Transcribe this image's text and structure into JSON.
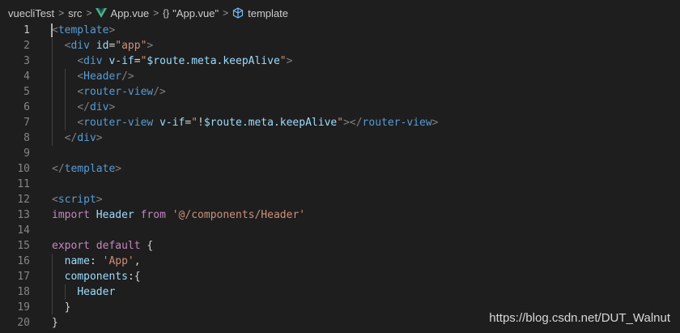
{
  "breadcrumb": {
    "folder1": "vuecliTest",
    "folder2": "src",
    "file": "App.vue",
    "braces": "{}",
    "symbol": "\"App.vue\"",
    "template": "template",
    "sep": ">"
  },
  "lines": [
    {
      "n": "1",
      "tokens": [
        [
          "punc",
          "<"
        ],
        [
          "tag",
          "template"
        ],
        [
          "punc",
          ">"
        ]
      ]
    },
    {
      "n": "2",
      "tokens": [
        [
          "op",
          "  "
        ],
        [
          "punc",
          "<"
        ],
        [
          "tag",
          "div"
        ],
        [
          "op",
          " "
        ],
        [
          "attr",
          "id"
        ],
        [
          "op",
          "="
        ],
        [
          "str",
          "\"app\""
        ],
        [
          "punc",
          ">"
        ]
      ]
    },
    {
      "n": "3",
      "tokens": [
        [
          "op",
          "    "
        ],
        [
          "punc",
          "<"
        ],
        [
          "tag",
          "div"
        ],
        [
          "op",
          " "
        ],
        [
          "attr",
          "v-if"
        ],
        [
          "op",
          "="
        ],
        [
          "str",
          "\""
        ],
        [
          "attr",
          "$route.meta.keepAlive"
        ],
        [
          "str",
          "\""
        ],
        [
          "punc",
          ">"
        ]
      ]
    },
    {
      "n": "4",
      "tokens": [
        [
          "op",
          "    "
        ],
        [
          "punc",
          "<"
        ],
        [
          "tag",
          "Header"
        ],
        [
          "punc",
          "/>"
        ]
      ]
    },
    {
      "n": "5",
      "tokens": [
        [
          "op",
          "    "
        ],
        [
          "punc",
          "<"
        ],
        [
          "tag",
          "router-view"
        ],
        [
          "punc",
          "/>"
        ]
      ]
    },
    {
      "n": "6",
      "tokens": [
        [
          "op",
          "    "
        ],
        [
          "punc",
          "</"
        ],
        [
          "tag",
          "div"
        ],
        [
          "punc",
          ">"
        ]
      ]
    },
    {
      "n": "7",
      "tokens": [
        [
          "op",
          "    "
        ],
        [
          "punc",
          "<"
        ],
        [
          "tag",
          "router-view"
        ],
        [
          "op",
          " "
        ],
        [
          "attr",
          "v-if"
        ],
        [
          "op",
          "="
        ],
        [
          "str",
          "\""
        ],
        [
          "op",
          "!"
        ],
        [
          "attr",
          "$route.meta.keepAlive"
        ],
        [
          "str",
          "\""
        ],
        [
          "punc",
          "></"
        ],
        [
          "tag",
          "router-view"
        ],
        [
          "punc",
          ">"
        ]
      ]
    },
    {
      "n": "8",
      "tokens": [
        [
          "op",
          "  "
        ],
        [
          "punc",
          "</"
        ],
        [
          "tag",
          "div"
        ],
        [
          "punc",
          ">"
        ]
      ]
    },
    {
      "n": "9",
      "tokens": []
    },
    {
      "n": "10",
      "tokens": [
        [
          "punc",
          "</"
        ],
        [
          "tag",
          "template"
        ],
        [
          "punc",
          ">"
        ]
      ]
    },
    {
      "n": "11",
      "tokens": []
    },
    {
      "n": "12",
      "tokens": [
        [
          "punc",
          "<"
        ],
        [
          "tag",
          "script"
        ],
        [
          "punc",
          ">"
        ]
      ]
    },
    {
      "n": "13",
      "tokens": [
        [
          "kw",
          "import"
        ],
        [
          "op",
          " "
        ],
        [
          "prop",
          "Header"
        ],
        [
          "op",
          " "
        ],
        [
          "kw",
          "from"
        ],
        [
          "op",
          " "
        ],
        [
          "str",
          "'@/components/Header'"
        ]
      ]
    },
    {
      "n": "14",
      "tokens": []
    },
    {
      "n": "15",
      "tokens": [
        [
          "kw",
          "export"
        ],
        [
          "op",
          " "
        ],
        [
          "kw",
          "default"
        ],
        [
          "op",
          " {"
        ]
      ]
    },
    {
      "n": "16",
      "tokens": [
        [
          "op",
          "  "
        ],
        [
          "prop",
          "name"
        ],
        [
          "op",
          ": "
        ],
        [
          "str",
          "'App'"
        ],
        [
          "op",
          ","
        ]
      ]
    },
    {
      "n": "17",
      "tokens": [
        [
          "op",
          "  "
        ],
        [
          "prop",
          "components"
        ],
        [
          "op",
          ":{"
        ]
      ]
    },
    {
      "n": "18",
      "tokens": [
        [
          "op",
          "    "
        ],
        [
          "prop",
          "Header"
        ]
      ]
    },
    {
      "n": "19",
      "tokens": [
        [
          "op",
          "  }"
        ]
      ]
    },
    {
      "n": "20",
      "tokens": [
        [
          "op",
          "}"
        ]
      ]
    }
  ],
  "watermark": "https://blog.csdn.net/DUT_Walnut",
  "colors": {
    "background": "#1e1e1e",
    "tag": "#569cd6",
    "string": "#ce9178",
    "attribute": "#9cdcfe",
    "keyword": "#c586c0",
    "vue_green": "#41b883"
  }
}
